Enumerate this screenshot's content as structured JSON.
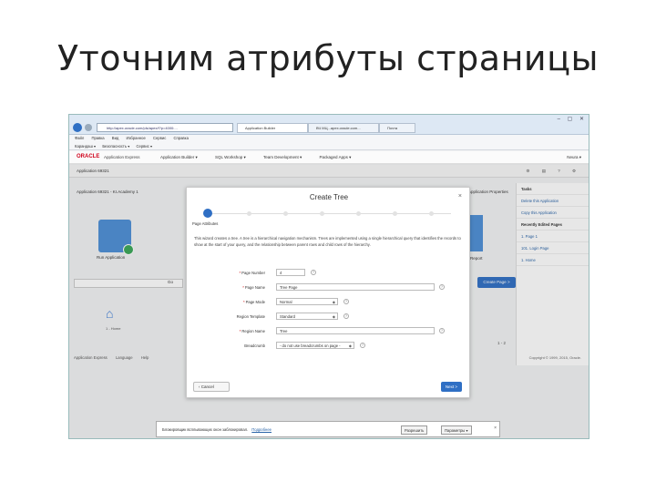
{
  "slide": {
    "title": "Уточним атрибуты страницы"
  },
  "browser": {
    "address": "http://apex.oracle.com/pls/apex/f?p=4000:...",
    "tabs": [
      {
        "label": "Application Builder"
      },
      {
        "label": "ВЧ МЦ...apex.oracle.com..."
      },
      {
        "label": "Почта"
      }
    ],
    "menu": [
      "Файл",
      "Правка",
      "Вид",
      "Избранное",
      "Сервис",
      "Справка"
    ],
    "favorites": [
      "Карандаш ▾",
      "Безопасность ▾",
      "Сервис ▾"
    ],
    "window_controls": "– ▢ ✕"
  },
  "apex": {
    "logo": "ORACLE",
    "product": "Application Express",
    "nav": [
      "Application Builder ▾",
      "SQL Workshop ▾",
      "Team Development ▾",
      "Packaged Apps ▾"
    ],
    "user": "Neura ▾",
    "app_crumb": "Application 69321",
    "tools": "⚙ ▤ ? ⚙",
    "page_crumb": "Application 69321 - KI.Academy 1",
    "props_label": "Application Properties",
    "right_panel": [
      {
        "label": "Tasks",
        "head": true
      },
      {
        "label": "Delete this Application"
      },
      {
        "label": "Copy this Application"
      },
      {
        "label": "Recently Edited Pages",
        "head": true
      },
      {
        "label": "1. Page 1"
      },
      {
        "label": "101. Login Page"
      },
      {
        "label": "1. Home"
      }
    ],
    "run_label": "Run Application",
    "report_label": "Report",
    "go_label": "Go",
    "create_button": "Create Page >",
    "home_label": "1 - Home",
    "pager": "1 - 2",
    "footer": [
      "Application Express",
      "Language",
      "Help"
    ],
    "copyright": "Copyright © 1999, 2015, Oracle."
  },
  "modal": {
    "title": "Create Tree",
    "close": "×",
    "wizard_step_label": "Page Attributes",
    "description": "This wizard creates a tree. A tree is a hierarchical navigation mechanism. Trees are implemented using a single hierarchical query that identifies the records to show at the start of your query, and the relationship between parent rows and child rows of the hierarchy.",
    "fields": [
      {
        "label": "Page Number",
        "value": "4",
        "required": true,
        "type": "text"
      },
      {
        "label": "Page Name",
        "value": "Tree Page",
        "required": true,
        "type": "text"
      },
      {
        "label": "Page Mode",
        "value": "Normal",
        "required": true,
        "type": "select"
      },
      {
        "label": "Region Template",
        "value": "Standard",
        "required": false,
        "type": "select"
      },
      {
        "label": "Region Name",
        "value": "Tree",
        "required": true,
        "type": "text"
      },
      {
        "label": "Breadcrumb",
        "value": "- do not use breadcrumbs on page -",
        "required": false,
        "type": "select"
      }
    ],
    "cancel_label": "Cancel",
    "next_label": "Next >"
  },
  "notification": {
    "text": "Блокировщик всплывающих окон заблокировал.",
    "link": "Подробнее",
    "allow_label": "Разрешить",
    "options_label": "Параметры ▾",
    "close": "×"
  }
}
